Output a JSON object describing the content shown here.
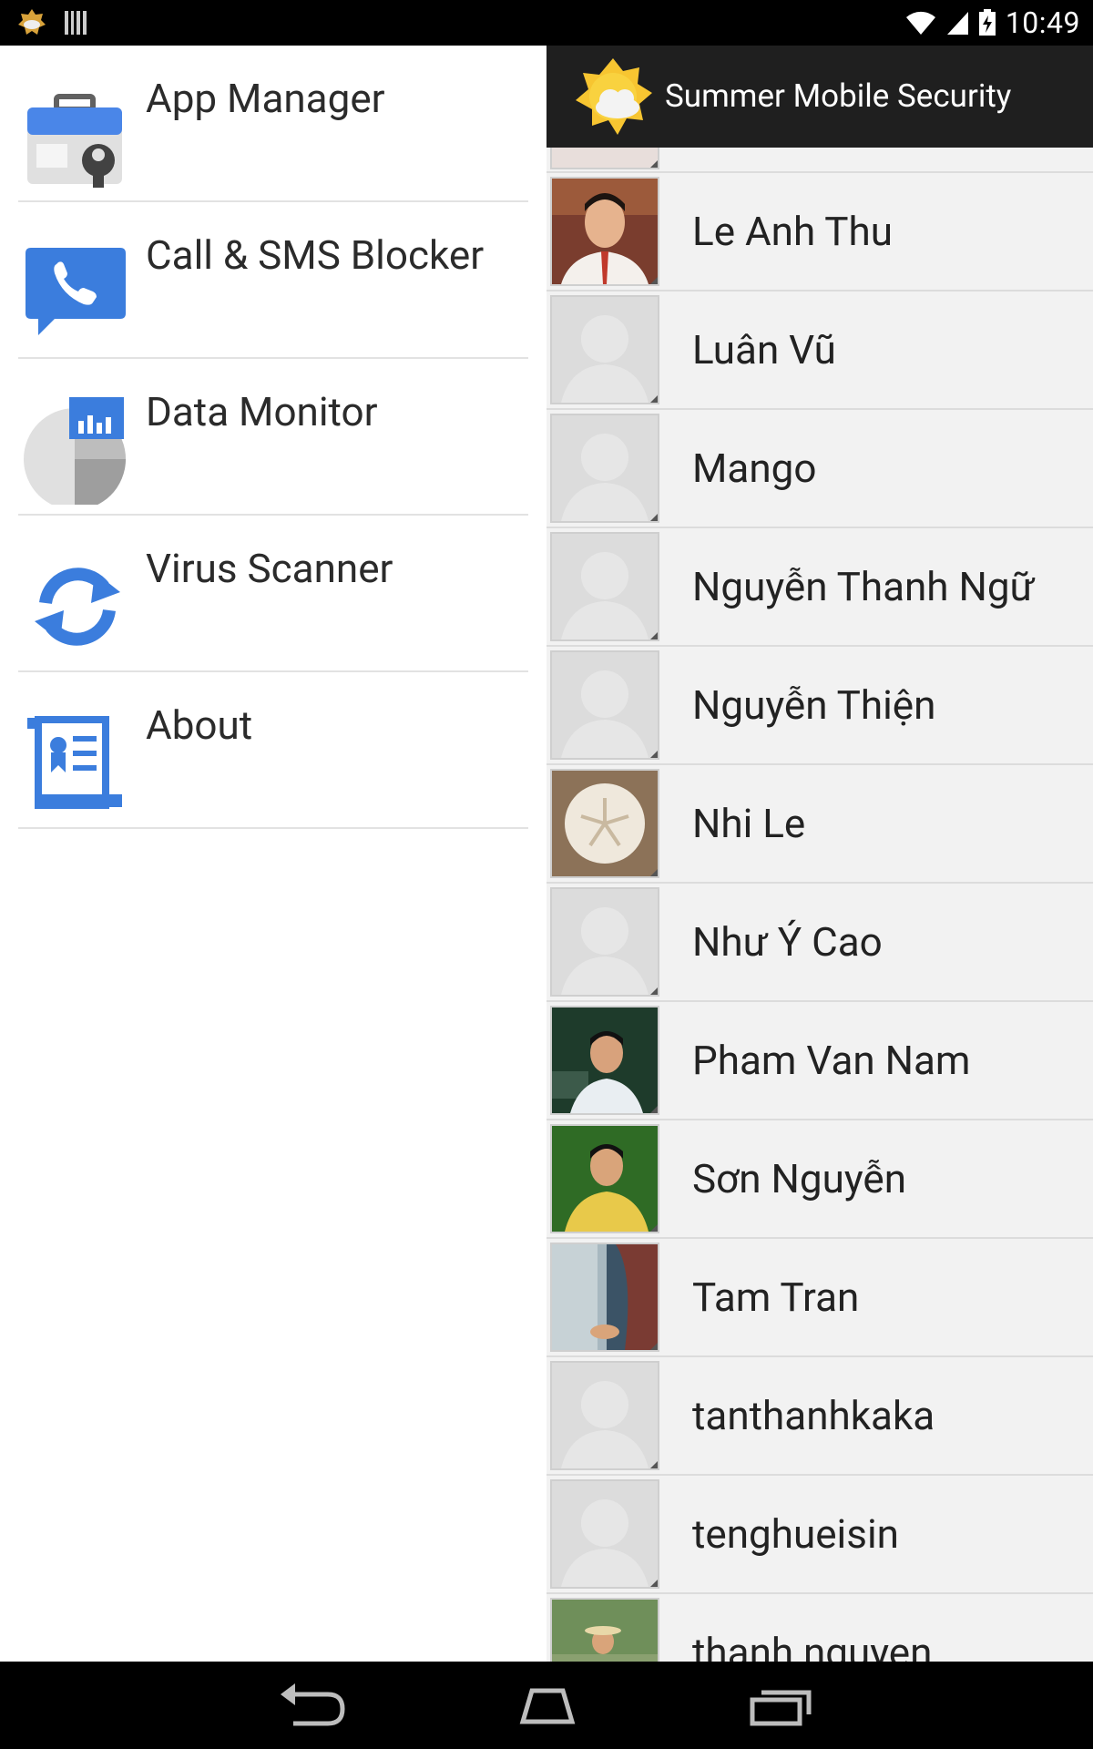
{
  "status_bar": {
    "time": "10:49",
    "icons": [
      "app-notification-icon",
      "barcode-icon",
      "wifi-icon",
      "signal-icon",
      "battery-charging-icon"
    ]
  },
  "action_bar": {
    "app_icon": "sun-cloud-icon",
    "title": "Summer Mobile Security"
  },
  "drawer": {
    "items": [
      {
        "label": "App Manager",
        "icon": "app-manager-icon"
      },
      {
        "label": "Call & SMS Blocker",
        "icon": "phone-chat-icon"
      },
      {
        "label": "Data Monitor",
        "icon": "pie-chart-icon"
      },
      {
        "label": "Virus Scanner",
        "icon": "sync-icon"
      },
      {
        "label": "About",
        "icon": "certificate-icon"
      }
    ]
  },
  "contacts": [
    {
      "name": "Le Anh Thu",
      "avatar": "photo"
    },
    {
      "name": "Luân Vũ",
      "avatar": "placeholder"
    },
    {
      "name": "Mango",
      "avatar": "placeholder"
    },
    {
      "name": "Nguyễn Thanh Ngữ",
      "avatar": "placeholder"
    },
    {
      "name": "Nguyễn Thiện",
      "avatar": "placeholder"
    },
    {
      "name": "Nhi Le",
      "avatar": "photo"
    },
    {
      "name": "Như Ý Cao",
      "avatar": "placeholder"
    },
    {
      "name": "Pham Van Nam",
      "avatar": "photo"
    },
    {
      "name": "Sơn Nguyễn",
      "avatar": "photo"
    },
    {
      "name": "Tam Tran",
      "avatar": "photo"
    },
    {
      "name": "tanthanhkaka",
      "avatar": "placeholder"
    },
    {
      "name": "tenghueisin",
      "avatar": "placeholder"
    },
    {
      "name": "thanh nguyen",
      "avatar": "photo"
    }
  ],
  "nav_bar": {
    "icons": [
      "back-icon",
      "home-icon",
      "recents-icon"
    ]
  },
  "colors": {
    "accent_blue": "#3b7ddd",
    "action_bar_bg": "#1f1f1f",
    "sun_yellow": "#f7c531"
  }
}
